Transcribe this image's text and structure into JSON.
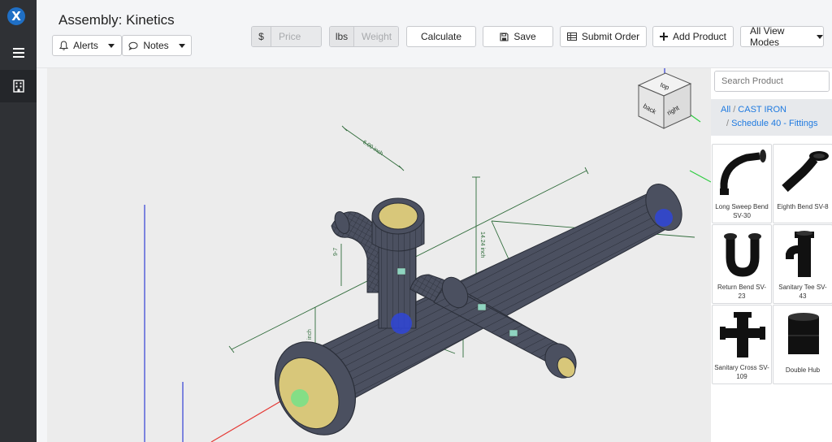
{
  "app": {
    "logo_letter": "X",
    "title": "Assembly: Kinetics"
  },
  "toolbar": {
    "alerts_label": "Alerts",
    "notes_label": "Notes",
    "price_symbol": "$",
    "price_placeholder": "Price",
    "weight_unit": "lbs",
    "weight_placeholder": "Weight",
    "calculate_label": "Calculate",
    "save_label": "Save",
    "submit_label": "Submit Order",
    "add_product_label": "Add Product",
    "view_modes_label": "All View Modes"
  },
  "viewcube": {
    "top": "top",
    "back": "back",
    "right": "right"
  },
  "dimensions": {
    "d1": "6.00 inch",
    "d2": "14.24 inch",
    "d3": "9-7",
    "d4": "inch"
  },
  "catalog": {
    "search_placeholder": "Search Product",
    "breadcrumb": [
      "All",
      "CAST IRON",
      "Schedule 40 - Fittings"
    ],
    "products": [
      {
        "name": "Long Sweep Bend SV-30",
        "icon": "long-sweep-bend-icon"
      },
      {
        "name": "Eighth Bend SV-8",
        "icon": "eighth-bend-icon"
      },
      {
        "name": "Return Bend SV-23",
        "icon": "return-bend-icon"
      },
      {
        "name": "Sanitary Tee SV-43",
        "icon": "sanitary-tee-icon"
      },
      {
        "name": "Sanitary Cross SV-109",
        "icon": "sanitary-cross-icon"
      },
      {
        "name": "Double Hub",
        "icon": "double-hub-icon"
      }
    ]
  },
  "colors": {
    "pipe": "#4b5060",
    "pipe_edge": "#2a2e38",
    "pipe_inner": "#d8c77a",
    "rail": "#2f3135",
    "link": "#1f7ae0",
    "axis_x": "#e53935",
    "axis_y": "#2ecc40",
    "axis_z": "#3340d6",
    "dimension": "#2f6b3a"
  }
}
